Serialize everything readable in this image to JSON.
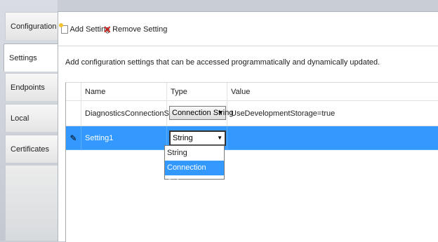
{
  "tabs": [
    {
      "label": "Configuration",
      "active": false
    },
    {
      "label": "Settings",
      "active": true
    },
    {
      "label": "Endpoints",
      "active": false
    },
    {
      "label": "Local Storage",
      "active": false
    },
    {
      "label": "Certificates",
      "active": false
    }
  ],
  "toolbar": {
    "add_label": "Add Setting",
    "remove_label": "Remove Setting"
  },
  "description": "Add configuration settings that can be accessed programmatically and dynamically updated.",
  "grid": {
    "columns": [
      "Name",
      "Type",
      "Value"
    ],
    "rows": [
      {
        "name": "DiagnosticsConnectionString",
        "type": "Connection String",
        "value": "UseDevelopmentStorage=true"
      },
      {
        "name": "Setting1",
        "type": "String",
        "value": ""
      }
    ]
  },
  "type_dropdown": {
    "options": [
      "String",
      "Connection String"
    ],
    "highlighted": "Connection String"
  },
  "icons": {
    "add": "add-setting-icon",
    "remove": "remove-icon",
    "edit": "pencil-icon",
    "arrow": "dropdown-arrow-icon"
  },
  "colors": {
    "selection": "#3399ff",
    "remove_icon": "#d0211c"
  }
}
